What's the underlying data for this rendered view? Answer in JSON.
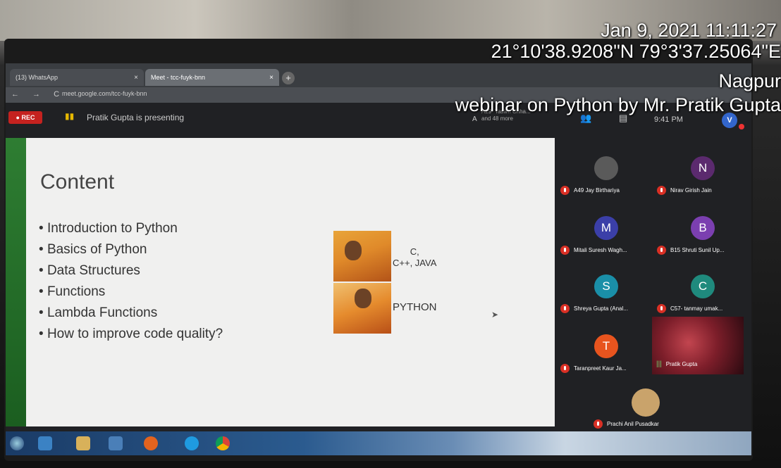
{
  "overlay": {
    "datetime": "Jan 9, 2021 11:11:27",
    "coords": "21°10'38.9208\"N 79°3'37.25064\"E",
    "city": "Nagpur",
    "caption": "webinar on Python by Mr. Pratik Gupta"
  },
  "browser": {
    "tab1_label": "(13) WhatsApp",
    "tab2_label": "Meet - tcc-fuyk-bnn",
    "tab_close": "×",
    "newtab": "+",
    "nav": "← → C",
    "url": "meet.google.com/tcc-fuyk-bnn"
  },
  "meet": {
    "rec_label": "REC",
    "presenting": "Pratik Gupta is presenting",
    "viewer_initial": "A",
    "viewer_line1": "A29- Taslim Chha...",
    "viewer_line2": "and 48 more",
    "clock": "9:41 PM",
    "me_initial": "V"
  },
  "slide": {
    "title": "Content",
    "bullets": [
      "Introduction to Python",
      "Basics of Python",
      "Data Structures",
      "Functions",
      "Lambda Functions",
      "How to improve code quality?"
    ],
    "meme_top_line1": "C,",
    "meme_top_line2": "C++, JAVA",
    "meme_bottom": "PYTHON"
  },
  "participants": [
    {
      "initial": "",
      "name": "A49 Jay Birthariya",
      "color": "#5a5a5a"
    },
    {
      "initial": "N",
      "name": "Nirav Girish Jain",
      "color": "#5b2a6e"
    },
    {
      "initial": "M",
      "name": "Mitali Suresh Wagh...",
      "color": "#3b3fa8"
    },
    {
      "initial": "B",
      "name": "B15 Shruti Sunil Up...",
      "color": "#7b3fb0"
    },
    {
      "initial": "S",
      "name": "Shreya Gupta (Anal...",
      "color": "#1a8fa8"
    },
    {
      "initial": "C",
      "name": "C57- tanmay umak...",
      "color": "#1f8a7d"
    },
    {
      "initial": "T",
      "name": "Taranpreet Kaur Ja...",
      "color": "#e8541e"
    },
    {
      "initial": "",
      "name": "Pratik Gupta",
      "color": "#000000"
    },
    {
      "initial": "",
      "name": "Prachi Anil Pusadkar",
      "color": "#c9a36b"
    }
  ]
}
